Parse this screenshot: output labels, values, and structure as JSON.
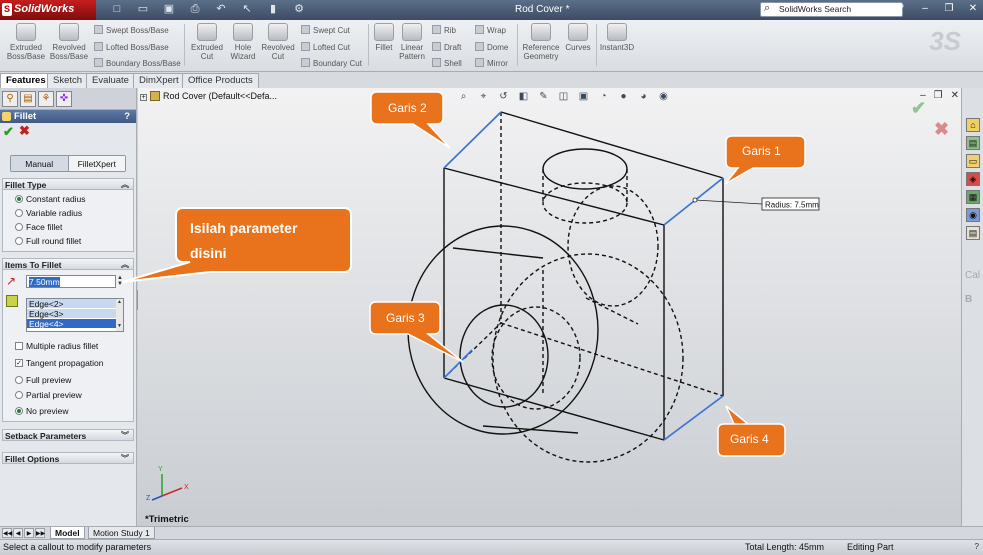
{
  "app": {
    "name": "SolidWorks",
    "doc_title": "Rod Cover *",
    "search_placeholder": "SolidWorks Search"
  },
  "title_icons": [
    "new-icon",
    "open-icon",
    "save-icon",
    "print-icon",
    "undo-icon",
    "select-icon",
    "rebuild-icon",
    "options-icon"
  ],
  "commands": {
    "extruded_boss": "Extruded Boss/Base",
    "revolved_boss": "Revolved Boss/Base",
    "swept_boss": "Swept Boss/Base",
    "lofted_boss": "Lofted Boss/Base",
    "boundary_boss": "Boundary Boss/Base",
    "extruded_cut": "Extruded Cut",
    "hole_wizard": "Hole Wizard",
    "revolved_cut": "Revolved Cut",
    "swept_cut": "Swept Cut",
    "lofted_cut": "Lofted Cut",
    "boundary_cut": "Boundary Cut",
    "fillet": "Fillet",
    "linear_pattern": "Linear Pattern",
    "rib": "Rib",
    "draft": "Draft",
    "shell": "Shell",
    "wrap": "Wrap",
    "dome": "Dome",
    "mirror": "Mirror",
    "reference_geometry": "Reference Geometry",
    "curves": "Curves",
    "instant3d": "Instant3D"
  },
  "tabs": [
    "Features",
    "Sketch",
    "Evaluate",
    "DimXpert",
    "Office Products"
  ],
  "property_manager": {
    "title": "Fillet",
    "help": "?",
    "mode_manual": "Manual",
    "mode_filletxpert": "FilletXpert",
    "fillet_type": {
      "heading": "Fillet Type",
      "options": [
        "Constant radius",
        "Variable radius",
        "Face fillet",
        "Full round fillet"
      ],
      "selected_index": 0
    },
    "items_to_fillet": {
      "heading": "Items To Fillet",
      "radius_value": "7.50mm",
      "edges": [
        "Edge<2>",
        "Edge<3>",
        "Edge<4>"
      ],
      "selected_edge_index": 2,
      "multiple_radius": "Multiple radius fillet",
      "multiple_radius_checked": false,
      "tangent_propagation": "Tangent propagation",
      "tangent_propagation_checked": true,
      "preview_options": [
        "Full preview",
        "Partial preview",
        "No preview"
      ],
      "preview_selected_index": 2
    },
    "setback_parameters": "Setback Parameters",
    "fillet_options": "Fillet Options"
  },
  "graphics": {
    "tree_item": "Rod Cover  (Default<<Defa...",
    "view_label": "*Trimetric",
    "radius_callout": "Radius: 7.5mm",
    "callouts": [
      "Garis 2",
      "Garis 1",
      "Garis 3",
      "Garis 4"
    ],
    "annotation": [
      "Isilah parameter",
      "disini"
    ],
    "triad_labels": [
      "Y",
      "X",
      "Z"
    ]
  },
  "taskpane_text": [
    "Cal",
    "B"
  ],
  "bottom_tabs": [
    "Model",
    "Motion Study 1"
  ],
  "status": {
    "message": "Select a callout to modify parameters",
    "total_length": "Total Length: 45mm",
    "mode": "Editing Part",
    "help": "?"
  },
  "colors": {
    "callout_orange": "#e8731c",
    "selected_edge_blue": "#3a78d8",
    "pm_header": "#4a6690"
  }
}
